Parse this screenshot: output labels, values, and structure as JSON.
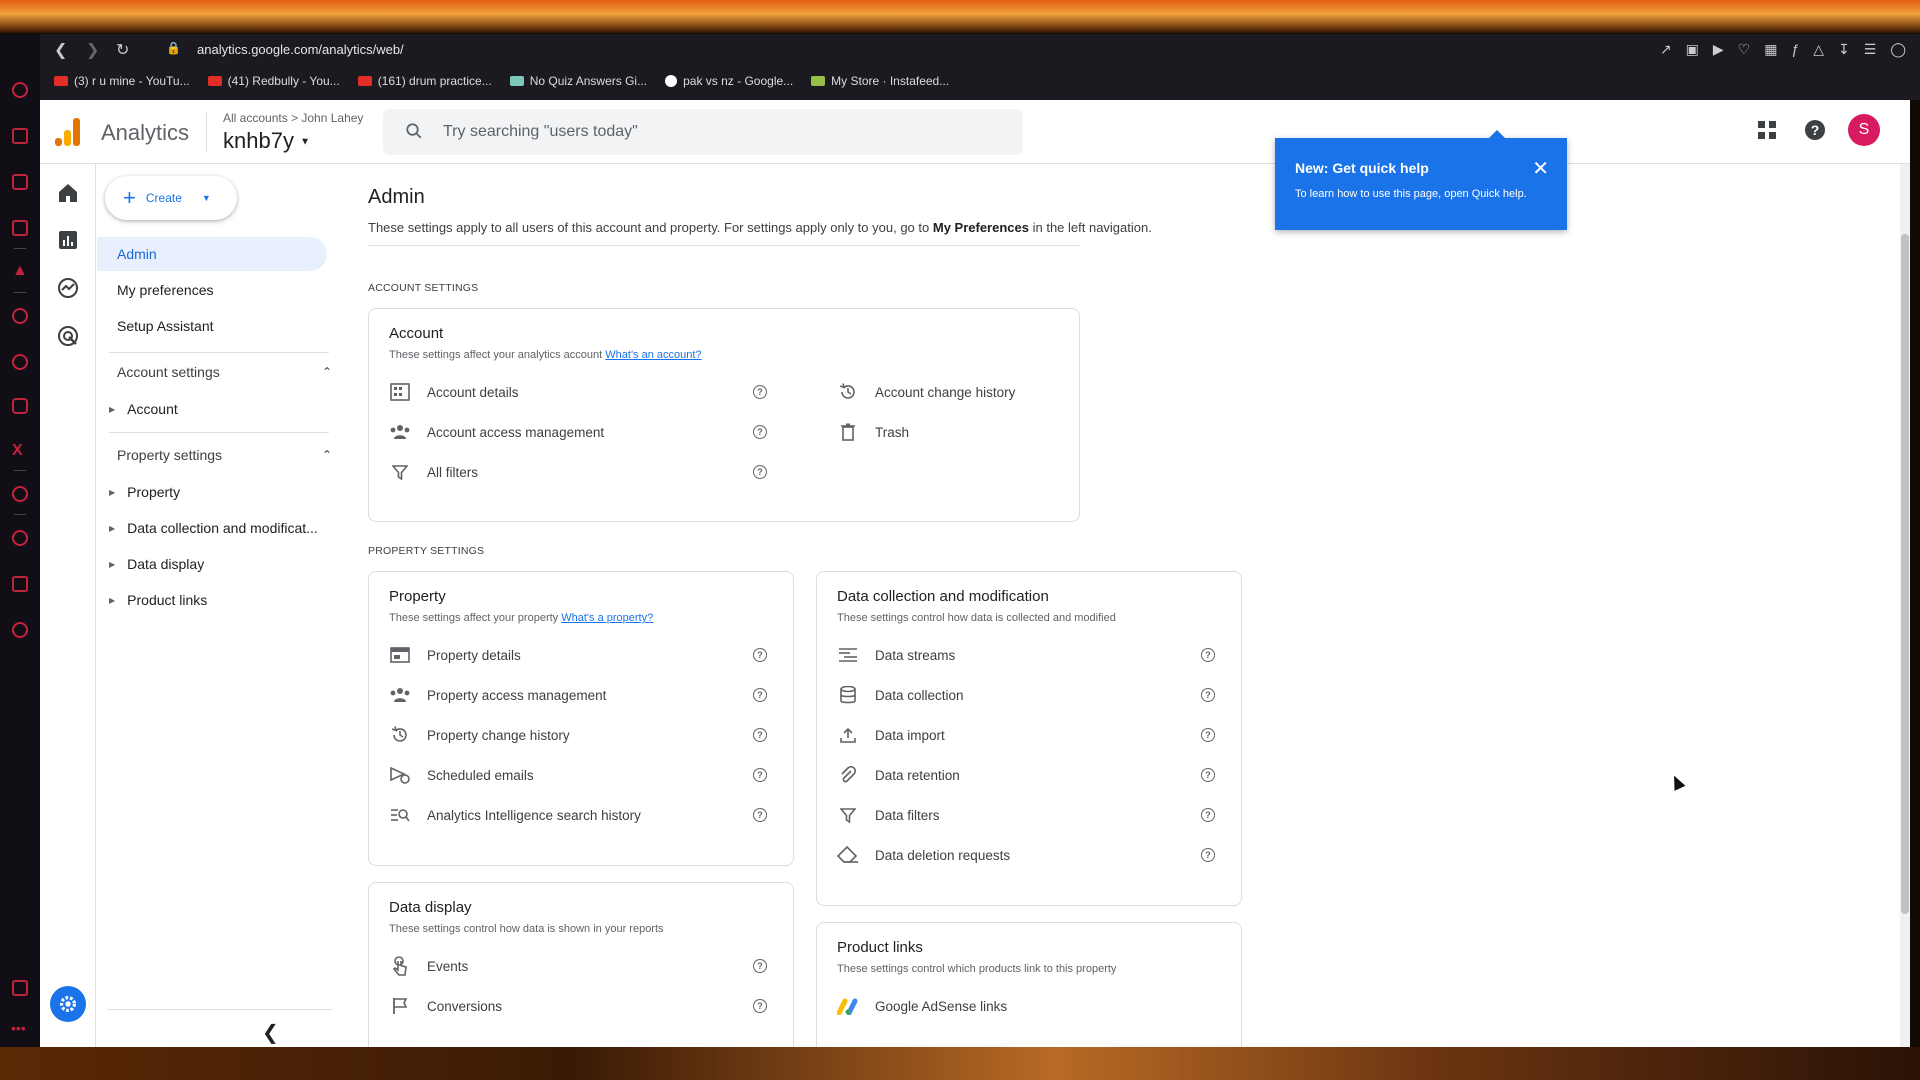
{
  "browser": {
    "url": "analytics.google.com/analytics/web/",
    "bookmarks": [
      {
        "label": "(3) r u mine - YouTu...",
        "color": "#e52d27"
      },
      {
        "label": "(41) Redbully - You...",
        "color": "#e52d27"
      },
      {
        "label": "(161) drum practice...",
        "color": "#e52d27"
      },
      {
        "label": "No Quiz Answers Gi...",
        "color": "#7cc8b6"
      },
      {
        "label": "pak vs nz - Google...",
        "color": "#ffffff"
      },
      {
        "label": "My Store · Instafeed...",
        "color": "#95bf47"
      }
    ]
  },
  "header": {
    "app_name": "Analytics",
    "breadcrumb": "All accounts > John Lahey",
    "property": "knhb7y",
    "search_placeholder": "Try searching \"users today\"",
    "avatar_letter": "S"
  },
  "nav": {
    "create_label": "Create",
    "items": [
      {
        "label": "Admin"
      },
      {
        "label": "My preferences"
      },
      {
        "label": "Setup Assistant"
      }
    ],
    "account_settings": "Account settings",
    "account_sub": [
      "Account"
    ],
    "property_settings": "Property settings",
    "property_sub": [
      "Property",
      "Data collection and modificat...",
      "Data display",
      "Product links"
    ]
  },
  "content": {
    "title": "Admin",
    "desc_pre": "These settings apply to all users of this account and property. For settings apply only to you, go to ",
    "desc_bold": "My Preferences",
    "desc_post": " in the left navigation.",
    "account_section": "ACCOUNT SETTINGS",
    "property_section": "PROPERTY SETTINGS",
    "account_card": {
      "title": "Account",
      "sub": "These settings affect your analytics account",
      "link": "What's an account?",
      "left": [
        "Account details",
        "Account access management",
        "All filters"
      ],
      "right": [
        "Account change history",
        "Trash"
      ]
    },
    "property_card": {
      "title": "Property",
      "sub": "These settings affect your property",
      "link": "What's a property?",
      "items": [
        "Property details",
        "Property access management",
        "Property change history",
        "Scheduled emails",
        "Analytics Intelligence search history"
      ]
    },
    "datacollection_card": {
      "title": "Data collection and modification",
      "sub": "These settings control how data is collected and modified",
      "items": [
        "Data streams",
        "Data collection",
        "Data import",
        "Data retention",
        "Data filters",
        "Data deletion requests"
      ]
    },
    "datadisplay_card": {
      "title": "Data display",
      "sub": "These settings control how data is shown in your reports",
      "items": [
        "Events",
        "Conversions"
      ]
    },
    "productlinks_card": {
      "title": "Product links",
      "sub": "These settings control which products link to this property",
      "items": [
        "Google AdSense links"
      ]
    }
  },
  "quick_help": {
    "title": "New: Get quick help",
    "text": "To learn how to use this page, open Quick help."
  },
  "colors": {
    "accent": "#1a73e8",
    "avatar": "#d81b60"
  }
}
